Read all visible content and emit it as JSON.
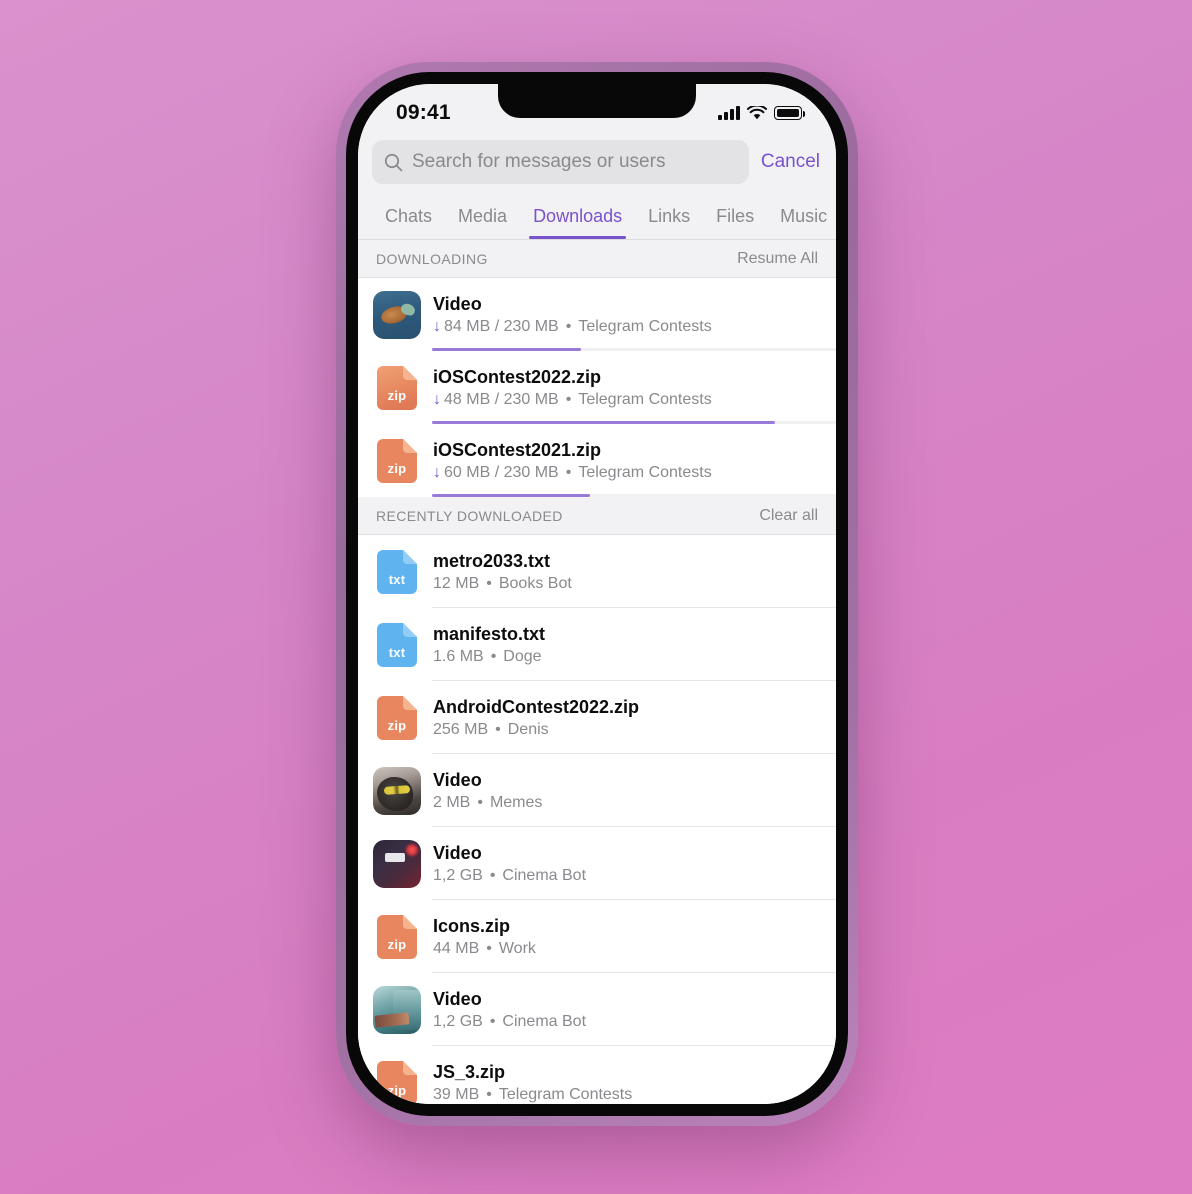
{
  "device": {
    "status_bar": {
      "time": "09:41",
      "signal_icon": "cellular-bars-icon",
      "wifi_icon": "wifi-icon",
      "battery_icon": "battery-full-icon"
    }
  },
  "search": {
    "icon": "search-icon",
    "placeholder": "Search for messages or users",
    "value": "",
    "cancel_label": "Cancel"
  },
  "tabs": [
    {
      "label": "Chats",
      "active": false
    },
    {
      "label": "Media",
      "active": false
    },
    {
      "label": "Downloads",
      "active": true
    },
    {
      "label": "Links",
      "active": false
    },
    {
      "label": "Files",
      "active": false
    },
    {
      "label": "Music",
      "active": false
    }
  ],
  "colors": {
    "accent": "#7a52cc",
    "progress_fill": "#9a7ad8",
    "secondary_text": "#8a8a8e",
    "zip_icon": "#e8835a",
    "txt_icon": "#5ab2ee",
    "background_pink": "#d687c8"
  },
  "downloading_section": {
    "title": "DOWNLOADING",
    "action_label": "Resume All",
    "items": [
      {
        "title": "Video",
        "downloaded": "84 MB",
        "total": "230 MB",
        "size_text": "84 MB / 230 MB",
        "source": "Telegram Contests",
        "progress_percent": 37,
        "icon": "video-thumbnail-turtle",
        "arrow_icon": "download-arrow-icon"
      },
      {
        "title": "iOSContest2022.zip",
        "downloaded": "48 MB",
        "total": "230 MB",
        "size_text": "48 MB / 230 MB",
        "source": "Telegram Contests",
        "progress_percent": 85,
        "icon": "zip-file-icon",
        "icon_ext": "zip",
        "arrow_icon": "download-arrow-icon"
      },
      {
        "title": "iOSContest2021.zip",
        "downloaded": "60 MB",
        "total": "230 MB",
        "size_text": "60 MB / 230 MB",
        "source": "Telegram Contests",
        "progress_percent": 39,
        "icon": "zip-file-icon",
        "icon_ext": "zip",
        "arrow_icon": "download-arrow-icon"
      }
    ]
  },
  "recent_section": {
    "title": "RECENTLY DOWNLOADED",
    "action_label": "Clear all",
    "items": [
      {
        "title": "metro2033.txt",
        "size": "12 MB",
        "source": "Books Bot",
        "icon": "txt-file-icon",
        "icon_ext": "txt"
      },
      {
        "title": "manifesto.txt",
        "size": "1.6 MB",
        "source": "Doge",
        "icon": "txt-file-icon",
        "icon_ext": "txt"
      },
      {
        "title": "AndroidContest2022.zip",
        "size": "256 MB",
        "source": "Denis",
        "icon": "zip-file-icon",
        "icon_ext": "zip"
      },
      {
        "title": "Video",
        "size": "2 MB",
        "source": "Memes",
        "icon": "video-thumbnail-cat"
      },
      {
        "title": "Video",
        "size": "1,2 GB",
        "source": "Cinema Bot",
        "icon": "video-thumbnail-dark"
      },
      {
        "title": "Icons.zip",
        "size": "44 MB",
        "source": "Work",
        "icon": "zip-file-icon",
        "icon_ext": "zip"
      },
      {
        "title": "Video",
        "size": "1,2 GB",
        "source": "Cinema Bot",
        "icon": "video-thumbnail-train"
      },
      {
        "title": "JS_3.zip",
        "size": "39 MB",
        "source": "Telegram Contests",
        "icon": "zip-file-icon",
        "icon_ext": "zip"
      }
    ]
  },
  "separator": "•"
}
